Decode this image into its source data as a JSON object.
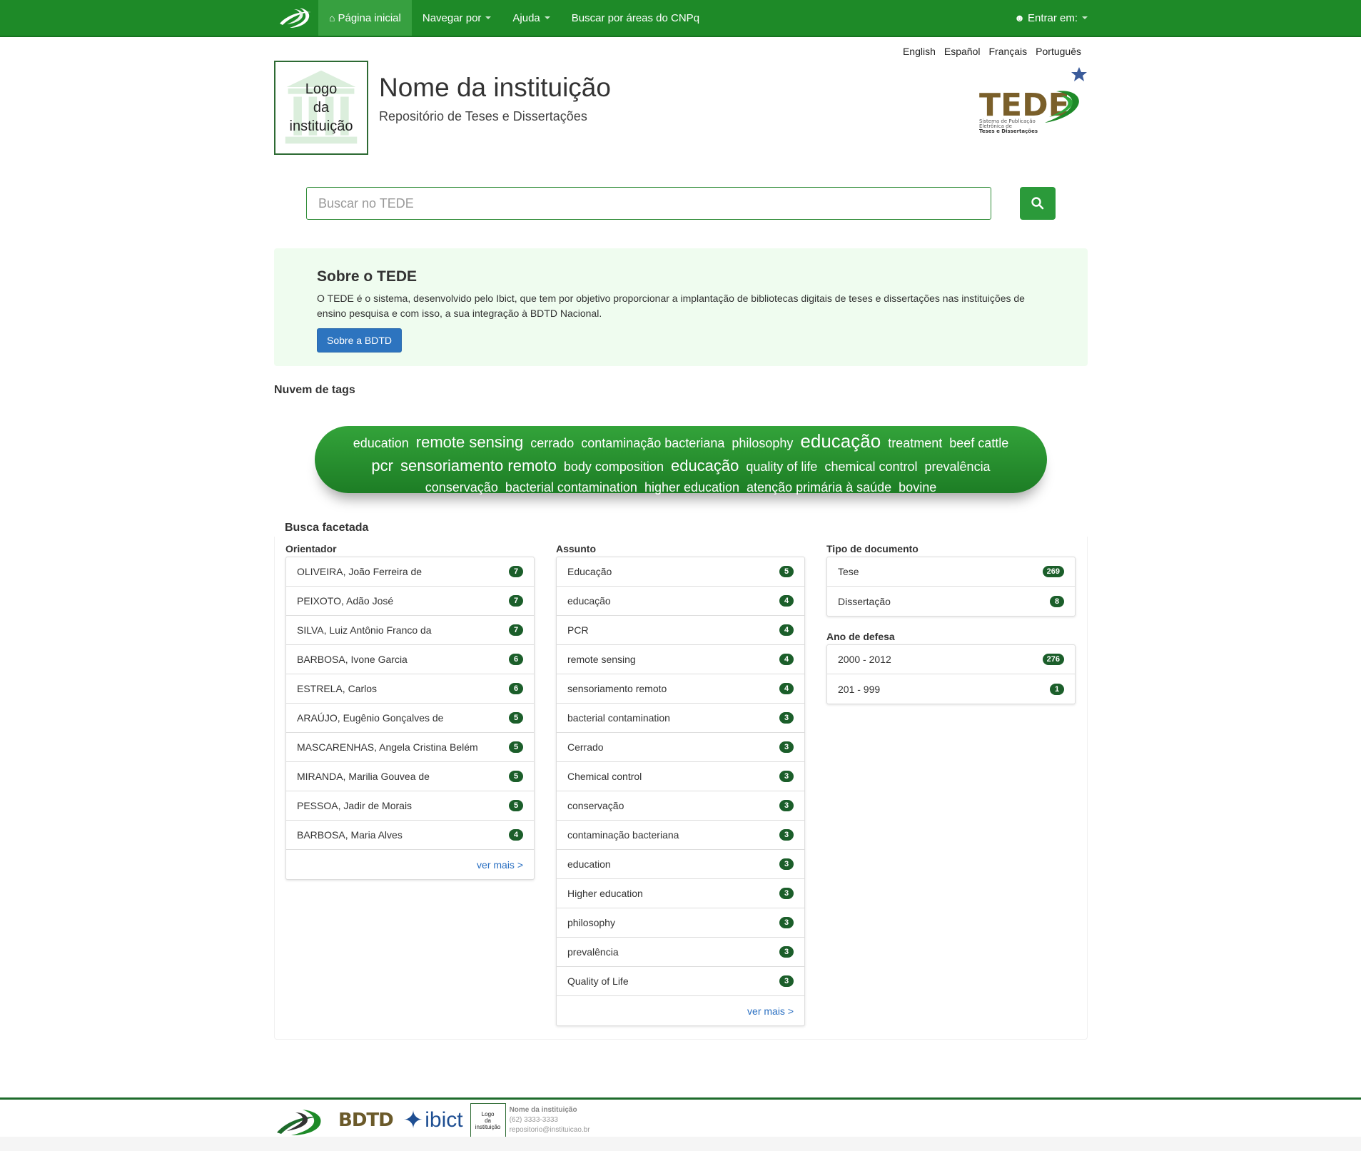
{
  "navbar": {
    "home": "Página inicial",
    "browse": "Navegar por",
    "help": "Ajuda",
    "cnpq": "Buscar por áreas do CNPq",
    "login": "Entrar em:"
  },
  "languages": [
    "English",
    "Español",
    "Français",
    "Português"
  ],
  "logo": {
    "line1": "Logo",
    "line2": "da",
    "line3": "instituição"
  },
  "institution": {
    "name": "Nome da instituição",
    "subtitle": "Repositório de Teses e Dissertações"
  },
  "tede_logo": {
    "wordmark": "TEDE",
    "tagline_1": "Sistema de Publicação",
    "tagline_2": "Eletrônica de",
    "tagline_3": "Teses e Dissertações"
  },
  "search": {
    "placeholder": "Buscar no TEDE"
  },
  "about": {
    "title": "Sobre o TEDE",
    "text": "O TEDE é o sistema, desenvolvido pelo Ibict, que tem por objetivo proporcionar a implantação de bibliotecas digitais de teses e dissertações nas instituições de ensino pesquisa e com isso, a sua integração à BDTD Nacional.",
    "button": "Sobre a BDTD"
  },
  "tag_cloud": {
    "title": "Nuvem de tags",
    "row1": [
      {
        "text": "education",
        "size": 1
      },
      {
        "text": "remote sensing",
        "size": 2
      },
      {
        "text": "cerrado",
        "size": 1
      },
      {
        "text": "contaminação bacteriana",
        "size": 1
      },
      {
        "text": "philosophy",
        "size": 1
      },
      {
        "text": "educação",
        "size": 3
      },
      {
        "text": "treatment",
        "size": 1
      },
      {
        "text": "beef cattle",
        "size": 1
      }
    ],
    "row2": [
      {
        "text": "pcr",
        "size": 2
      },
      {
        "text": "sensoriamento remoto",
        "size": 2
      },
      {
        "text": "body composition",
        "size": 1
      },
      {
        "text": "educação",
        "size": 2
      },
      {
        "text": "quality of life",
        "size": 1
      },
      {
        "text": "chemical control",
        "size": 1
      },
      {
        "text": "prevalência",
        "size": 1
      }
    ],
    "row3": [
      {
        "text": "conservação",
        "size": 1
      },
      {
        "text": "bacterial contamination",
        "size": 1
      },
      {
        "text": "higher education",
        "size": 1
      },
      {
        "text": "atenção primária à saúde",
        "size": 1
      },
      {
        "text": "bovine",
        "size": 1
      }
    ]
  },
  "facets": {
    "title": "Busca facetada",
    "more_label": "ver mais >",
    "orientador": {
      "title": "Orientador",
      "items": [
        {
          "label": "OLIVEIRA, João Ferreira de",
          "count": "7"
        },
        {
          "label": "PEIXOTO, Adão José",
          "count": "7"
        },
        {
          "label": "SILVA, Luiz Antônio Franco da",
          "count": "7"
        },
        {
          "label": "BARBOSA, Ivone Garcia",
          "count": "6"
        },
        {
          "label": "ESTRELA, Carlos",
          "count": "6"
        },
        {
          "label": "ARAÚJO, Eugênio Gonçalves de",
          "count": "5"
        },
        {
          "label": "MASCARENHAS, Angela Cristina Belém",
          "count": "5"
        },
        {
          "label": "MIRANDA, Marilia Gouvea de",
          "count": "5"
        },
        {
          "label": "PESSOA, Jadir de Morais",
          "count": "5"
        },
        {
          "label": "BARBOSA, Maria Alves",
          "count": "4"
        }
      ]
    },
    "assunto": {
      "title": "Assunto",
      "items": [
        {
          "label": "Educação",
          "count": "5"
        },
        {
          "label": "educação",
          "count": "4"
        },
        {
          "label": "PCR",
          "count": "4"
        },
        {
          "label": "remote sensing",
          "count": "4"
        },
        {
          "label": "sensoriamento remoto",
          "count": "4"
        },
        {
          "label": "bacterial contamination",
          "count": "3"
        },
        {
          "label": "Cerrado",
          "count": "3"
        },
        {
          "label": "Chemical control",
          "count": "3"
        },
        {
          "label": "conservação",
          "count": "3"
        },
        {
          "label": "contaminação bacteriana",
          "count": "3"
        },
        {
          "label": "education",
          "count": "3"
        },
        {
          "label": "Higher education",
          "count": "3"
        },
        {
          "label": "philosophy",
          "count": "3"
        },
        {
          "label": "prevalência",
          "count": "3"
        },
        {
          "label": "Quality of Life",
          "count": "3"
        }
      ]
    },
    "tipo": {
      "title": "Tipo de documento",
      "items": [
        {
          "label": "Tese",
          "count": "269"
        },
        {
          "label": "Dissertação",
          "count": "8"
        }
      ]
    },
    "ano": {
      "title": "Ano de defesa",
      "items": [
        {
          "label": "2000 - 2012",
          "count": "276"
        },
        {
          "label": "201 - 999",
          "count": "1"
        }
      ]
    }
  },
  "footer": {
    "bdtd": "BDTD",
    "ibict": "ibict",
    "logo_text_1": "Logo",
    "logo_text_2": "da",
    "logo_text_3": "instituição",
    "inst_name": "Nome da instituição",
    "phone": "(62) 3333-3333",
    "email": "repositorio@instituicao.br"
  },
  "colors": {
    "primary_green": "#1e8a28",
    "badge": "#1b5e2a",
    "link": "#2b70c2"
  }
}
